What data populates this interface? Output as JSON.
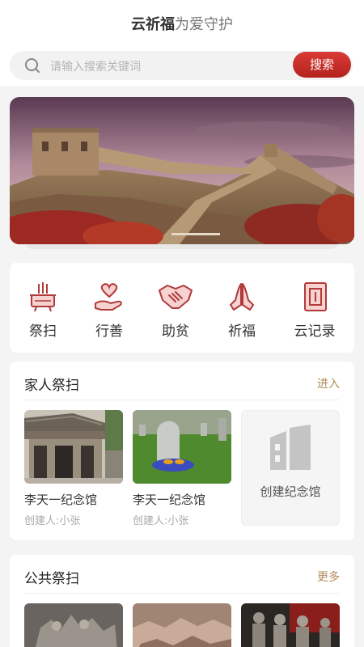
{
  "header": {
    "title_strong": "云祈福",
    "title_light": "为爱守护"
  },
  "search": {
    "placeholder": "请输入搜索关键词",
    "button_label": "搜索",
    "icon": "search-icon"
  },
  "banner": {
    "image": "great-wall-photo"
  },
  "menu": {
    "items": [
      {
        "label": "祭扫",
        "icon": "incense-burner-icon"
      },
      {
        "label": "行善",
        "icon": "heart-hand-icon"
      },
      {
        "label": "助贫",
        "icon": "handshake-icon"
      },
      {
        "label": "祈福",
        "icon": "praying-hands-icon"
      },
      {
        "label": "云记录",
        "icon": "record-book-icon"
      }
    ]
  },
  "family": {
    "title": "家人祭扫",
    "link": "进入",
    "halls": [
      {
        "name": "李天一纪念馆",
        "creator": "创建人:小张",
        "image": "ancestral-hall-photo"
      },
      {
        "name": "李天一纪念馆",
        "creator": "创建人:小张",
        "image": "tombstone-photo"
      }
    ],
    "create_label": "创建纪念馆",
    "create_icon": "building-icon"
  },
  "public": {
    "title": "公共祭扫",
    "link": "更多",
    "images": [
      "relief-sculpture-photo",
      "mountain-relief-photo",
      "statues-photo"
    ]
  },
  "colors": {
    "accent": "#c0312c",
    "link": "#b08a5a",
    "icon_red": "#b23a3a",
    "icon_fill": "#f6d2d0"
  }
}
